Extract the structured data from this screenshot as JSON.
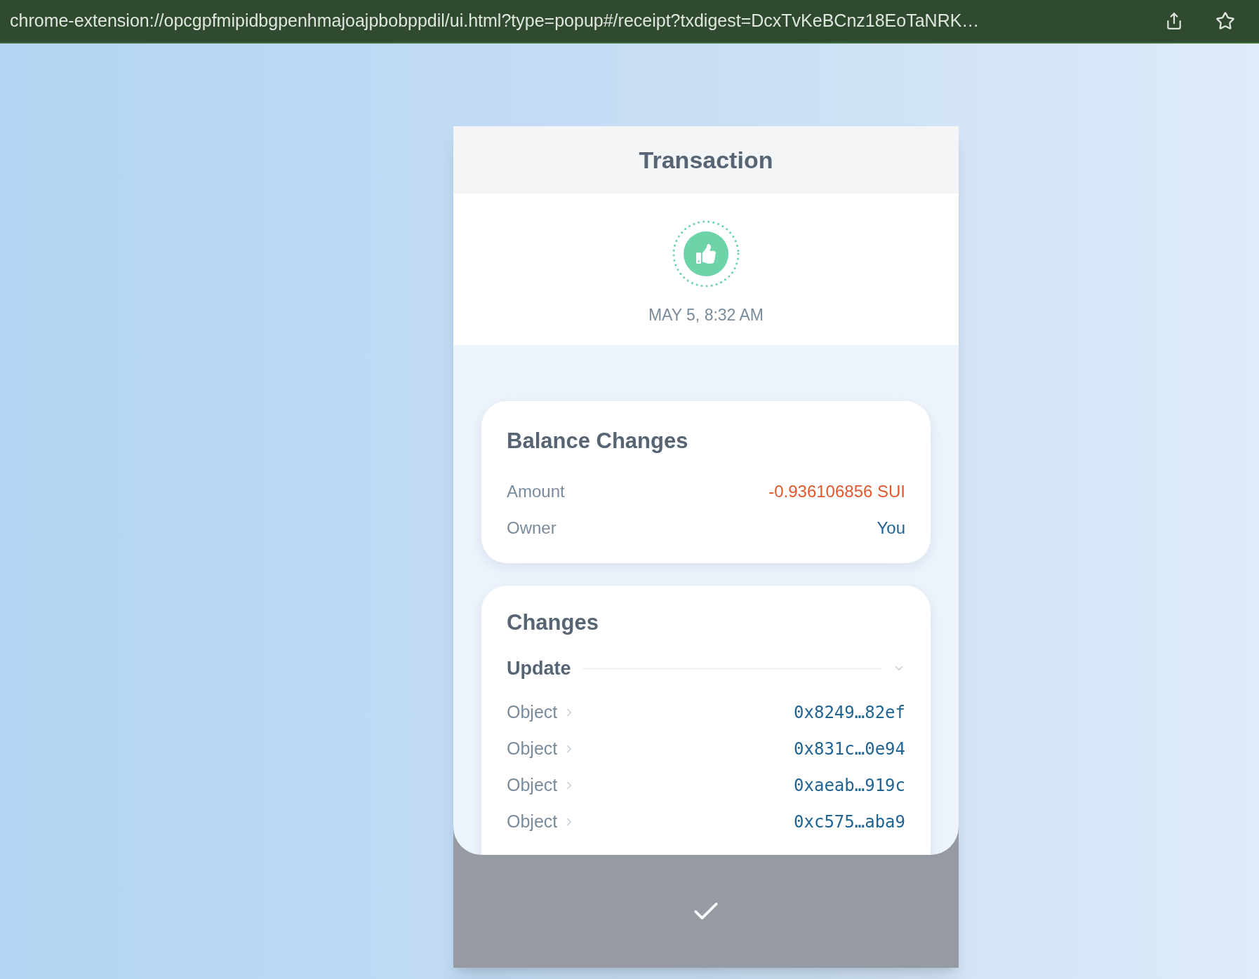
{
  "address_bar": {
    "url": "chrome-extension://opcgpfmipidbgpenhmajoajpbobppdil/ui.html?type=popup#/receipt?txdigest=DcxTvKeBCnz18EoTaNRK…"
  },
  "header": {
    "title": "Transaction"
  },
  "status": {
    "kind": "success",
    "time": "MAY 5, 8:32 AM"
  },
  "balance_changes": {
    "title": "Balance Changes",
    "rows": [
      {
        "label": "Amount",
        "value": "-0.936106856 SUI",
        "kind": "negative"
      },
      {
        "label": "Owner",
        "value": "You",
        "kind": "owner"
      }
    ]
  },
  "changes": {
    "title": "Changes",
    "group": {
      "label": "Update",
      "expanded": true
    },
    "rows": [
      {
        "label": "Object",
        "value": "0x8249…82ef"
      },
      {
        "label": "Object",
        "value": "0x831c…0e94"
      },
      {
        "label": "Object",
        "value": "0xaeab…919c"
      },
      {
        "label": "Object",
        "value": "0xc575…aba9"
      }
    ]
  }
}
